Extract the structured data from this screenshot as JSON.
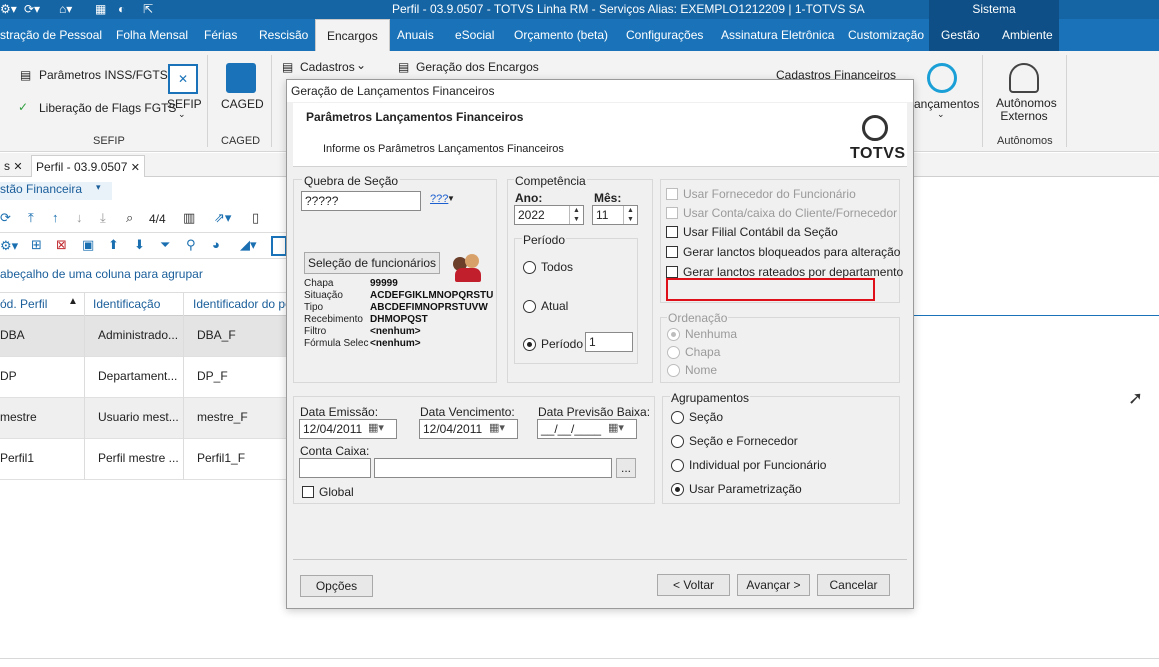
{
  "window": {
    "title": "Perfil - 03.9.0507 - TOTVS Linha RM - Serviços  Alias: EXEMPLO1212209 | 1-TOTVS SA",
    "system_label": "Sistema"
  },
  "menu": {
    "tabs": [
      "stração de Pessoal",
      "Folha Mensal",
      "Férias",
      "Rescisão",
      "Encargos",
      "Anuais",
      "eSocial",
      "Orçamento (beta)",
      "Configurações",
      "Assinatura Eletrônica",
      "Customização",
      "Gestão",
      "Ambiente"
    ],
    "active": "Encargos"
  },
  "ribbon": {
    "params_inss": "Parâmetros INSS/FGTS",
    "liberacao_flags": "Liberação de Flags FGTS",
    "sefip": "SEFIP",
    "sefip_group": "SEFIP",
    "caged": "CAGED",
    "caged_group": "CAGED",
    "cadastros": "Cadastros",
    "geracao_encargos": "Geração dos Encargos",
    "cadastros_financeiros": "Cadastros Financeiros",
    "lancamentos": "ançamentos",
    "autonomos_externos": "Autônomos Externos",
    "autonomos_group": "Autônomos"
  },
  "doc_tabs": {
    "tab1": "s",
    "tab2": "Perfil - 03.9.0507"
  },
  "left_panel": {
    "view_select": "stão Financeira",
    "pager": "4/4",
    "group_hint": "abeçalho de uma coluna para agrupar",
    "columns": [
      "ód. Perfil",
      "Identificação",
      "Identificador do per"
    ],
    "rows": [
      [
        "DBA",
        "Administrado...",
        "DBA_F"
      ],
      [
        "DP",
        "Departament...",
        "DP_F"
      ],
      [
        "mestre",
        "Usuario mest...",
        "mestre_F"
      ],
      [
        "Perfil1",
        "Perfil mestre ...",
        "Perfil1_F"
      ]
    ]
  },
  "dialog": {
    "title": "Geração de Lançamentos Financeiros",
    "header_title": "Parâmetros Lançamentos Financeiros",
    "header_subtitle": "Informe os Parâmetros Lançamentos Financeiros",
    "brand": "TOTVS",
    "quebra_secao_label": "Quebra de Seção",
    "quebra_secao_value": "?????",
    "quebra_icon_text": "???",
    "selecao_button": "Seleção de funcionários",
    "info_keys": [
      "Chapa",
      "Situação",
      "Tipo",
      "Recebimento",
      "Filtro",
      "Fórmula Selec"
    ],
    "info_values": [
      "99999",
      "ACDEFGIKLMNOPQRSTU",
      "ABCDEFIMNOPRSTUVW",
      "DHMOPQST",
      "<nenhum>",
      "<nenhum>"
    ],
    "competencia_label": "Competência",
    "ano_label": "Ano:",
    "ano_value": "2022",
    "mes_label": "Mês:",
    "mes_value": "11",
    "periodo_group": "Período",
    "periodo_options": [
      "Todos",
      "Atual",
      "Período"
    ],
    "periodo_value": "1",
    "options": {
      "usar_fornecedor": "Usar Fornecedor do Funcionário",
      "usar_conta": "Usar Conta/caixa do Cliente/Fornecedor",
      "usar_filial": "Usar Filial Contábil da Seção",
      "gerar_bloqueados": "Gerar lanctos bloqueados para alteração",
      "gerar_rateados": "Gerar lanctos rateados por departamento"
    },
    "ordenacao_label": "Ordenação",
    "ordenacao_options": [
      "Nenhuma",
      "Chapa",
      "Nome"
    ],
    "data_emissao_label": "Data Emissão:",
    "data_emissao_value": "12/04/2011",
    "data_vencimento_label": "Data Vencimento:",
    "data_vencimento_value": "12/04/2011",
    "data_previsao_label": "Data Previsão Baixa:",
    "data_previsao_value": "__/__/____",
    "conta_caixa_label": "Conta Caixa:",
    "conta_caixa_code": "",
    "conta_caixa_desc": "",
    "browse_button": "...",
    "global_label": "Global",
    "agrupamentos_label": "Agrupamentos",
    "agrupamentos_options": [
      "Seção",
      "Seção e Fornecedor",
      "Individual por Funcionário",
      "Usar Parametrização"
    ],
    "btn_opcoes": "Opções",
    "btn_voltar": "< Voltar",
    "btn_avancar": "Avançar >",
    "btn_cancelar": "Cancelar"
  },
  "colors": {
    "titlebar": "#1565a5",
    "menubar": "#1a73b8",
    "highlight_box": "#e0101a"
  }
}
